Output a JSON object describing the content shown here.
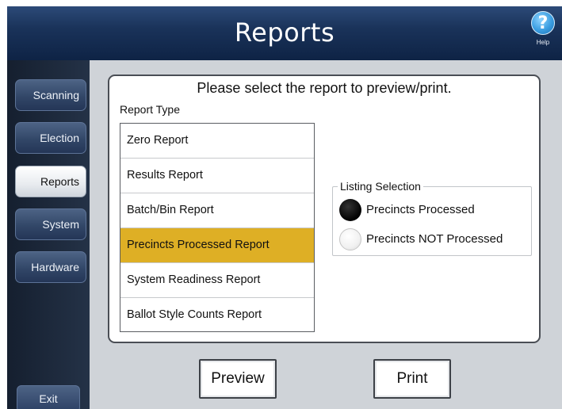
{
  "header": {
    "title": "Reports",
    "help_label": "Help",
    "help_icon": "help-icon"
  },
  "nav": {
    "items": [
      {
        "label": "Scanning",
        "active": false
      },
      {
        "label": "Election",
        "active": false
      },
      {
        "label": "Reports",
        "active": true
      },
      {
        "label": "System",
        "active": false
      },
      {
        "label": "Hardware",
        "active": false
      }
    ],
    "exit_label": "Exit"
  },
  "panel": {
    "prompt": "Please select the report to preview/print.",
    "report_type_label": "Report Type",
    "reports": [
      "Zero Report",
      "Results Report",
      "Batch/Bin Report",
      "Precincts Processed Report",
      "System Readiness Report",
      "Ballot Style Counts Report"
    ],
    "selected_report": "Precincts Processed Report",
    "listing": {
      "legend": "Listing Selection",
      "options": [
        "Precincts Processed",
        "Precincts NOT Processed"
      ],
      "selected": "Precincts Processed"
    }
  },
  "actions": {
    "preview_label": "Preview",
    "print_label": "Print"
  },
  "colors": {
    "header_bg": "#1a335a",
    "selected_row": "#deaf25",
    "nav_bg": "#1c2738"
  }
}
